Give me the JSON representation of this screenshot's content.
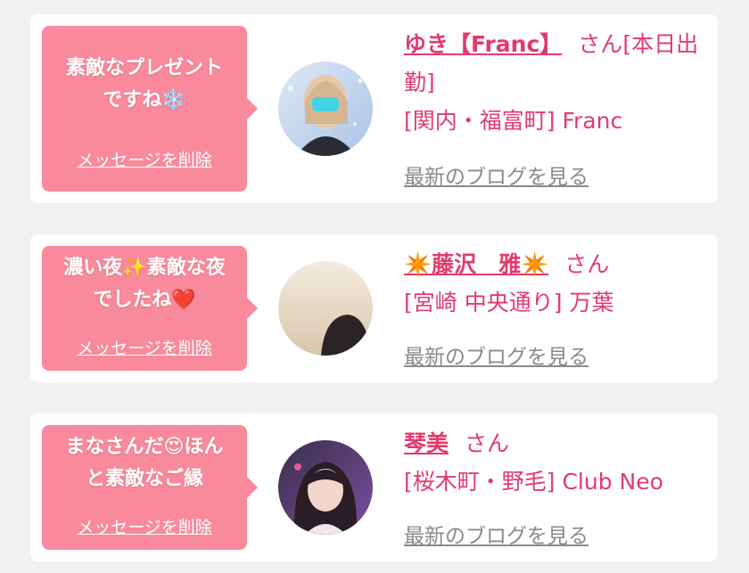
{
  "cards": [
    {
      "message_line1": "素敵なプレゼント",
      "message_line2": "ですね❄️",
      "delete_label": "メッセージを削除",
      "name": "ゆき【Franc】",
      "honorific": "さん",
      "status": "[本日出勤]",
      "shop": "[関内・福富町] Franc",
      "blog_label": "最新のブログを見る"
    },
    {
      "message_line1": "濃い夜✨素敵な夜",
      "message_line2": "でしたね❤️",
      "delete_label": "メッセージを削除",
      "name": "✴️藤沢　雅✴️",
      "honorific": "さん",
      "shop": "[宮崎 中央通り] 万葉",
      "blog_label": "最新のブログを見る"
    },
    {
      "message_line1": "まなさんだ😍ほん",
      "message_line2": "と素敵なご縁",
      "delete_label": "メッセージを削除",
      "name": "琴美",
      "honorific": "さん",
      "shop": "[桜木町・野毛] Club Neo",
      "blog_label": "最新のブログを見る"
    }
  ],
  "colors": {
    "bubble": "#f88a9b",
    "accent": "#e23b6e",
    "link_gray": "#8a8a8a",
    "background": "#f3f0f1"
  }
}
